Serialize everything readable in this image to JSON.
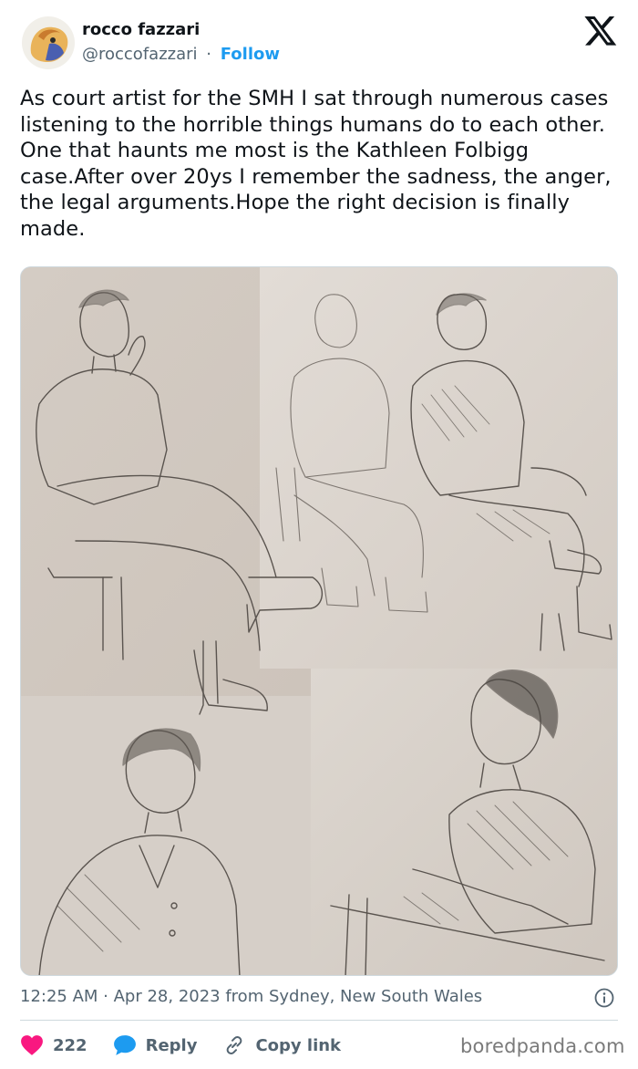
{
  "author": {
    "name": "rocco fazzari",
    "handle": "@roccofazzari",
    "separator": "·",
    "follow_label": "Follow"
  },
  "tweet": {
    "text": "As court artist for the SMH I sat through numerous cases listening to the horrible things humans do to each other. One that haunts me most is the Kathleen Folbigg case.After over 20ys I remember the sadness, the anger, the legal arguments.Hope the right decision is finally made."
  },
  "meta": {
    "timestamp": "12:25 AM · Apr 28, 2023 from Sydney, New South Wales"
  },
  "actions": {
    "like_count": "222",
    "reply_label": "Reply",
    "copy_link_label": "Copy link"
  },
  "watermark": "boredpanda.com",
  "icons": {
    "brand": "x-logo-icon",
    "like": "heart-icon",
    "reply": "speech-bubble-icon",
    "copy": "link-icon",
    "info": "info-icon"
  },
  "colors": {
    "link": "#1d9bf0",
    "like": "#f91880",
    "secondary_text": "#536471",
    "text": "#0f1419"
  }
}
